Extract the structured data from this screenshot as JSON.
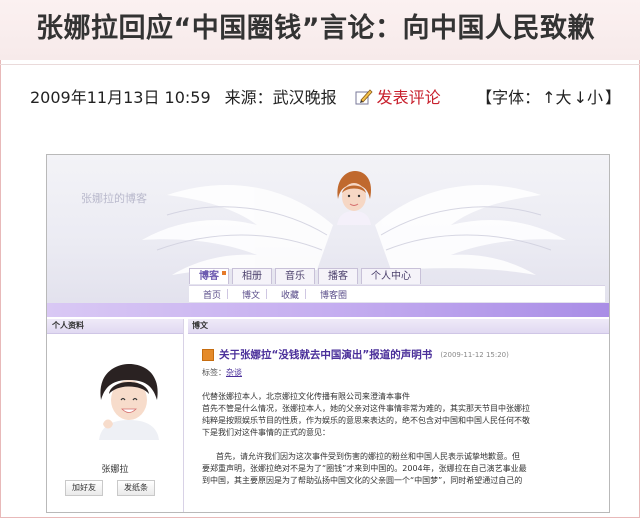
{
  "article": {
    "headline": "张娜拉回应“中国圈钱”言论：向中国人民致歉",
    "date": "2009年11月13日 10:59",
    "source": "来源：武汉晚报",
    "comment_label": "发表评论",
    "font_size_prefix": "【字体：",
    "font_size_large": "↑大",
    "font_size_small": "↓小",
    "font_size_suffix": "】"
  },
  "blog": {
    "header_title": "张娜拉的博客",
    "tabs": [
      "博客",
      "相册",
      "音乐",
      "播客",
      "个人中心"
    ],
    "subnav": [
      "首页",
      "博文",
      "收藏",
      "博客圈"
    ],
    "sidebar_title": "个人资料",
    "profile_name": "张娜拉",
    "add_friend": "加好友",
    "send_message": "发纸条",
    "main_title": "博文",
    "post_title": "关于张娜拉“没钱就去中国演出”报道的声明书",
    "post_time": "(2009-11-12 15:20)",
    "tags_label": "标签：",
    "tags_value": "杂谈",
    "paragraphs": [
      "代替张娜拉本人，北京娜拉文化传播有限公司来澄清本事件",
      "首先不管是什么情况，张娜拉本人，她的父亲对这件事情非常为难的，其实那天节目中张娜拉",
      "纯粹是按照娱乐节目的性质，作为娱乐的意思来表达的，绝不包含对中国和中国人民任何不敬",
      "下是我们对这件事情的正式的意见：",
      "首先，请允许我们因为这次事件受到伤害的娜拉的粉丝和中国人民表示诚挚地歉意。但",
      "要郑重声明，张娜拉绝对不是为了“圈钱”才来到中国的。2004年，张娜拉在自己演艺事业最",
      "到中国，其主要原因是为了帮助弘扬中国文化的父亲圆一个“中国梦”，同时希望通过自己的"
    ]
  }
}
